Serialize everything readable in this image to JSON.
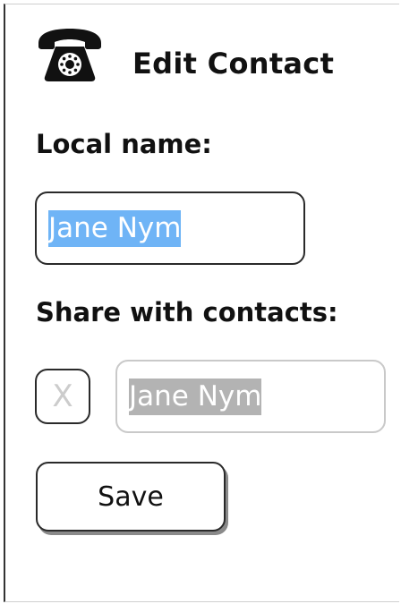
{
  "header": {
    "icon": "telephone-icon",
    "title": "Edit Contact"
  },
  "local_name": {
    "label": "Local name:",
    "value": "Jane Nym"
  },
  "share": {
    "label": "Share with contacts:",
    "checkbox_mark": "X",
    "checkbox_checked": false,
    "value": "Jane Nym"
  },
  "actions": {
    "save_label": "Save"
  },
  "colors": {
    "selection": "#6fb4f6",
    "disabled_selection": "#b3b3b3",
    "border": "#2a2a2a"
  }
}
